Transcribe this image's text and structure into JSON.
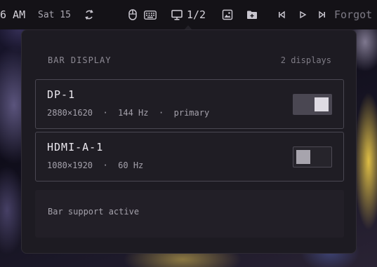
{
  "topbar": {
    "time": "6 AM",
    "date": "Sat 15",
    "refresh_icon": "refresh-icon",
    "mouse_icon": "mouse-icon",
    "keyboard_icon": "keyboard-icon",
    "monitor_icon": "monitor-icon",
    "workspace": "1/2",
    "screenshot_icon": "screenshot-icon",
    "folder_icon": "folder-icon",
    "prev_icon": "skip-previous-icon",
    "play_icon": "play-icon",
    "next_icon": "skip-next-icon",
    "window_title": "Forgot"
  },
  "panel": {
    "title": "BAR DISPLAY",
    "count": "2 displays",
    "displays": [
      {
        "name": "DP-1",
        "meta": "2880×1620  ·  144 Hz  ·  primary",
        "enabled": true
      },
      {
        "name": "HDMI-A-1",
        "meta": "1080×1920  ·  60 Hz",
        "enabled": false
      }
    ],
    "status": "Bar support active"
  },
  "colors": {
    "panel_bg": "#1d1b22",
    "topbar_bg": "#141217",
    "toggle_on_knob": "#dedbe3",
    "toggle_off_knob": "#a7a4ad"
  }
}
